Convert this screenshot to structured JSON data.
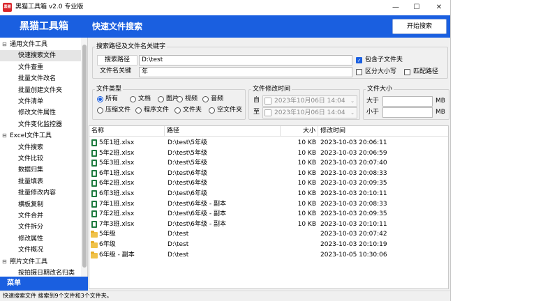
{
  "window": {
    "title": "黑猫工具箱 v2.0 专业版",
    "icon_text": "黑猫",
    "controls": {
      "minimize": "—",
      "maximize": "☐",
      "close": "✕"
    }
  },
  "sidebar": {
    "header": "黑猫工具箱",
    "groups": [
      {
        "label": "通用文件工具",
        "toggle": "⊟",
        "items": [
          "快速搜索文件",
          "文件查重",
          "批量文件改名",
          "批量创建文件夹",
          "文件清单",
          "修改文件属性",
          "文件变化监控器"
        ]
      },
      {
        "label": "Excel文件工具",
        "toggle": "⊟",
        "items": [
          "文件搜索",
          "文件比较",
          "数据归集",
          "批量填表",
          "批量修改内容",
          "横板复制",
          "文件合并",
          "文件拆分",
          "修改属性",
          "文件概况"
        ]
      },
      {
        "label": "照片文件工具",
        "toggle": "⊟",
        "items": [
          "按拍摄日期改名归类"
        ]
      }
    ],
    "selected_item": "快速搜索文件",
    "menu_label": "菜单"
  },
  "main": {
    "title": "快速文件搜索",
    "start_button": "开始搜索",
    "search_section": {
      "legend": "搜索路径及文件名关键字",
      "path_label": "搜索路径",
      "path_value": "D:\\test",
      "keyword_label": "文件名关键",
      "keyword_value": "年",
      "include_subfolders": {
        "label": "包含子文件夹",
        "checked": true
      },
      "case_sensitive": {
        "label": "区分大小写",
        "checked": false
      },
      "match_path": {
        "label": "匹配路径",
        "checked": false
      }
    },
    "file_type": {
      "legend": "文件类型",
      "options": [
        "所有",
        "文档",
        "图片",
        "视频",
        "音频",
        "压缩文件",
        "程序文件",
        "文件夹",
        "空文件夹"
      ],
      "selected": "所有"
    },
    "modified_time": {
      "legend": "文件修改时间",
      "from_label": "自",
      "to_label": "至",
      "from_value": "2023年10月06日 14:04",
      "to_value": "2023年10月06日 14:04",
      "arrow": "⌄"
    },
    "file_size": {
      "legend": "文件大小",
      "greater_label": "大于",
      "less_label": "小于",
      "unit": "MB"
    },
    "results": {
      "columns": [
        "名称",
        "路径",
        "大小",
        "修改时间"
      ],
      "rows": [
        {
          "type": "xlsx",
          "name": "5年1班.xlsx",
          "path": "D:\\test\\5年级",
          "size": "10 KB",
          "mtime": "2023-10-03 20:06:11"
        },
        {
          "type": "xlsx",
          "name": "5年2班.xlsx",
          "path": "D:\\test\\5年级",
          "size": "10 KB",
          "mtime": "2023-10-03 20:06:59"
        },
        {
          "type": "xlsx",
          "name": "5年3班.xlsx",
          "path": "D:\\test\\5年级",
          "size": "10 KB",
          "mtime": "2023-10-03 20:07:40"
        },
        {
          "type": "xlsx",
          "name": "6年1班.xlsx",
          "path": "D:\\test\\6年级",
          "size": "10 KB",
          "mtime": "2023-10-03 20:08:33"
        },
        {
          "type": "xlsx",
          "name": "6年2班.xlsx",
          "path": "D:\\test\\6年级",
          "size": "10 KB",
          "mtime": "2023-10-03 20:09:35"
        },
        {
          "type": "xlsx",
          "name": "6年3班.xlsx",
          "path": "D:\\test\\6年级",
          "size": "10 KB",
          "mtime": "2023-10-03 20:10:11"
        },
        {
          "type": "xlsx",
          "name": "7年1班.xlsx",
          "path": "D:\\test\\6年级 - 副本",
          "size": "10 KB",
          "mtime": "2023-10-03 20:08:33"
        },
        {
          "type": "xlsx",
          "name": "7年2班.xlsx",
          "path": "D:\\test\\6年级 - 副本",
          "size": "10 KB",
          "mtime": "2023-10-03 20:09:35"
        },
        {
          "type": "xlsx",
          "name": "7年3班.xlsx",
          "path": "D:\\test\\6年级 - 副本",
          "size": "10 KB",
          "mtime": "2023-10-03 20:10:11"
        },
        {
          "type": "folder",
          "name": "5年级",
          "path": "D:\\test",
          "size": "",
          "mtime": "2023-10-03 20:07:42"
        },
        {
          "type": "folder",
          "name": "6年级",
          "path": "D:\\test",
          "size": "",
          "mtime": "2023-10-03 20:10:19"
        },
        {
          "type": "folder",
          "name": "6年级 - 副本",
          "path": "D:\\test",
          "size": "",
          "mtime": "2023-10-05 10:30:06"
        }
      ]
    }
  },
  "status": {
    "text": "快速搜索文件   搜索到9个文件和3个文件夹。"
  }
}
